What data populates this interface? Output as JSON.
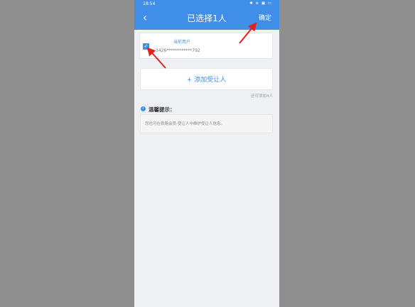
{
  "status_bar": {
    "time": "18:54",
    "icons": "✱ ≋ ▣ ▭"
  },
  "header": {
    "back_icon": "‹",
    "title": "已选择1人",
    "confirm_label": "确定"
  },
  "user_card": {
    "checkbox_icon": "✓",
    "current_user_label": "当前用户",
    "user_id": "3426************792"
  },
  "add_card": {
    "label": "+ 添加受让人"
  },
  "remaining_text": "还可添加4人",
  "tips": {
    "icon": "i",
    "title": "温馨提示：",
    "content": "您也可在铁路会员-受让人中维护受让人信息。"
  },
  "colors": {
    "accent": "#3f8fe8",
    "arrow": "#e0231c"
  }
}
